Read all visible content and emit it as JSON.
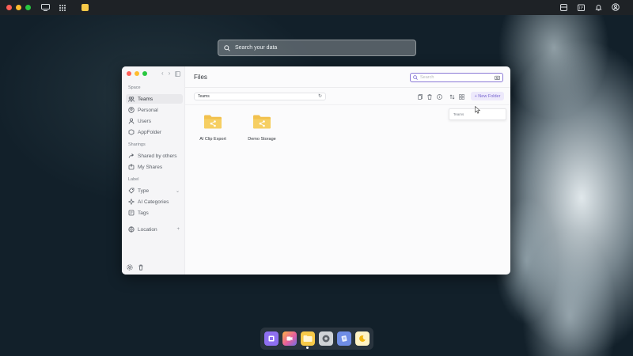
{
  "topbar": {
    "left_icons": [
      "screen-mirror-icon",
      "grid-apps-icon",
      "notes-app-icon"
    ],
    "right_icons": [
      "archive-icon",
      "calendar-icon",
      "bell-icon",
      "account-icon"
    ]
  },
  "global_search": {
    "placeholder": "Search your data"
  },
  "window": {
    "title": "Files",
    "search_placeholder": "Search",
    "sidebar": {
      "sections": [
        {
          "title": "Space",
          "items": [
            {
              "label": "Teams",
              "icon": "team-icon",
              "active": true
            },
            {
              "label": "Personal",
              "icon": "personal-icon"
            },
            {
              "label": "Users",
              "icon": "user-icon"
            },
            {
              "label": "AppFolder",
              "icon": "app-folder-icon"
            }
          ]
        },
        {
          "title": "Sharings",
          "items": [
            {
              "label": "Shared by others",
              "icon": "shared-icon"
            },
            {
              "label": "My Shares",
              "icon": "my-shares-icon"
            }
          ]
        },
        {
          "title": "Label",
          "items": [
            {
              "label": "Type",
              "icon": "type-icon",
              "trail": "⌄"
            },
            {
              "label": "AI Categories",
              "icon": "ai-categories-icon"
            },
            {
              "label": "Tags",
              "icon": "tag-icon"
            }
          ]
        },
        {
          "title": "",
          "items": [
            {
              "label": "Location",
              "icon": "location-icon",
              "trail": "+"
            }
          ]
        }
      ]
    },
    "breadcrumb": "Teams",
    "new_folder_label": "+ New Folder",
    "dropdown_text": "Teams",
    "files": [
      {
        "name": "AI Clip Export"
      },
      {
        "name": "Demo Storage"
      }
    ]
  },
  "dock": {
    "apps": [
      "media-app-icon",
      "video-app-icon",
      "files-app-icon",
      "settings-app-icon",
      "editor-app-icon",
      "moon-app-icon"
    ],
    "colors": [
      "#8e6ff0",
      "#e65f9c",
      "#f7c948",
      "#cfd3d7",
      "#6f8de6",
      "#f7d54a"
    ]
  },
  "colors": {
    "accent": "#7866d0",
    "folder": "#f2c14e"
  }
}
